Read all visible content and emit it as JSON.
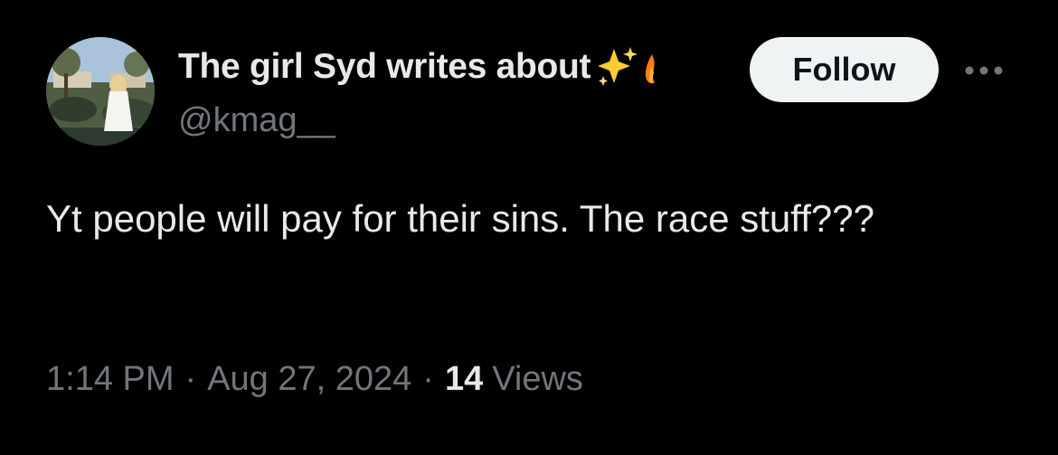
{
  "author": {
    "display_name": "The girl Syd writes about",
    "emoji_icons": [
      "sparkles-icon",
      "flame-icon"
    ],
    "handle": "@kmag__"
  },
  "actions": {
    "follow_label": "Follow",
    "more_icon": "more-horizontal-icon"
  },
  "tweet": {
    "text": "Yt people will pay for their sins. The race stuff???"
  },
  "meta": {
    "time": "1:14 PM",
    "separator": "·",
    "date": "Aug 27, 2024",
    "views_count": "14",
    "views_label": "Views"
  },
  "colors": {
    "background": "#000000",
    "primary_text": "#e7e9ea",
    "secondary_text": "#71767b",
    "follow_button_bg": "#eff3f4",
    "follow_button_text": "#0f1419",
    "sparkle": "#ffcc33"
  }
}
